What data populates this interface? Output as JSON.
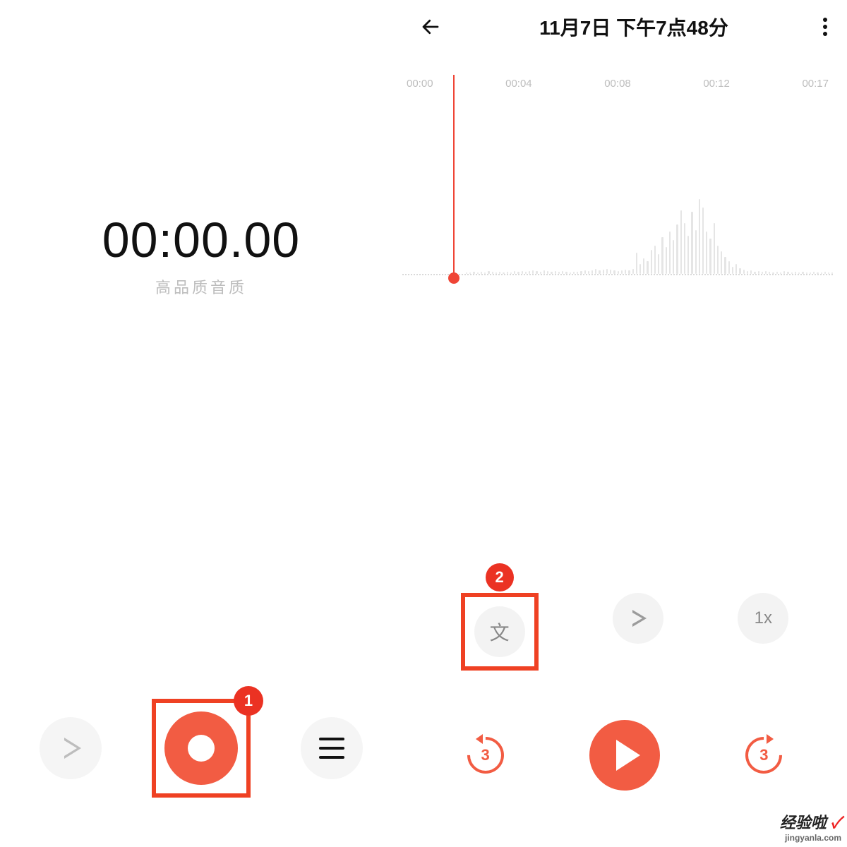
{
  "left": {
    "timer": "00:00.00",
    "quality": "高品质音质"
  },
  "badges": {
    "one": "1",
    "two": "2"
  },
  "right": {
    "title": "11月7日 下午7点48分",
    "ticks": [
      "00:00",
      "00:04",
      "00:08",
      "00:12",
      "00:17"
    ],
    "text_btn": "文",
    "speed_btn": "1x",
    "skip_back": "3",
    "skip_fwd": "3"
  },
  "waveform": [
    2,
    2,
    3,
    2,
    3,
    2,
    4,
    3,
    2,
    3,
    2,
    3,
    2,
    4,
    3,
    4,
    3,
    4,
    5,
    4,
    3,
    5,
    4,
    3,
    4,
    3,
    4,
    3,
    2,
    3,
    3,
    4,
    5,
    4,
    5,
    7,
    5,
    6,
    7,
    6,
    5,
    4,
    5,
    6,
    5,
    7,
    30,
    14,
    22,
    18,
    34,
    40,
    28,
    52,
    38,
    60,
    48,
    70,
    90,
    72,
    54,
    88,
    62,
    106,
    94,
    60,
    50,
    72,
    40,
    32,
    24,
    18,
    10,
    14,
    8,
    6,
    4,
    5,
    3,
    4,
    3,
    4,
    3,
    2,
    3,
    2,
    4,
    3,
    2,
    3,
    2,
    3,
    2,
    2,
    3,
    2,
    2,
    3,
    2,
    2
  ],
  "watermark": {
    "brand": "经验啦",
    "check": "✓",
    "url": "jingyanla.com"
  }
}
